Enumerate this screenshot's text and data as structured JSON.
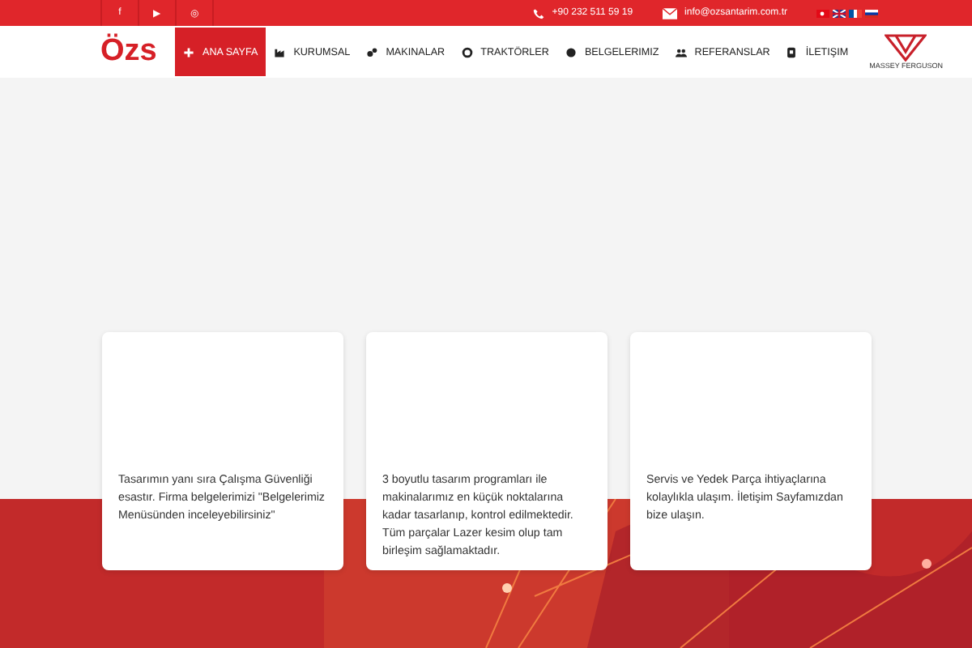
{
  "top_bar": {
    "social": [
      "f",
      "▶",
      "◎"
    ],
    "phone": "+90 232 511 59 19",
    "email": "info@ozsantarim.com.tr"
  },
  "logo": {
    "text": "Özs"
  },
  "nav": [
    {
      "label": "ANA SAYFA",
      "selected": true,
      "kind": "plus"
    },
    {
      "label": "KURUMSAL",
      "selected": false,
      "kind": "factory"
    },
    {
      "label": "MAKINALAR",
      "selected": false,
      "kind": "gears"
    },
    {
      "label": "TRAKTÖRLER",
      "selected": false,
      "kind": "gear"
    },
    {
      "label": "BELGELERIMIZ",
      "selected": false,
      "kind": "badge"
    },
    {
      "label": "REFERANSLAR",
      "selected": false,
      "kind": "users"
    },
    {
      "label": "İLETIŞIM",
      "selected": false,
      "kind": "phone"
    }
  ],
  "brand": {
    "text": "MASSEY FERGUSON"
  },
  "cards": [
    {
      "text": "Tasarımın yanı sıra Çalışma Güvenliği esastır. Firma belgelerimizi \"Belgelerimiz Menüsünden inceleyebilirsiniz\""
    },
    {
      "text": "3 boyutlu tasarım programları ile makinalarımız en küçük noktalarına kadar tasarlanıp, kontrol edilmektedir. Tüm parçalar Lazer kesim olup tam birleşim sağlamaktadır."
    },
    {
      "text": "Servis ve Yedek Parça ihtiyaçlarına kolaylıkla ulaşım. İletişim Sayfamızdan bize ulaşın."
    }
  ]
}
